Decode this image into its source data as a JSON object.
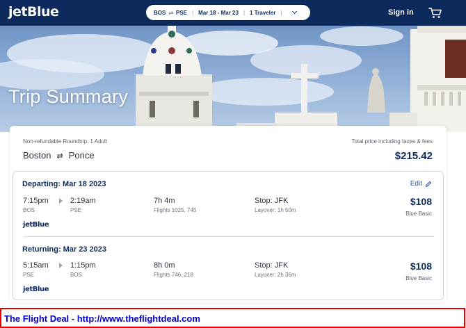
{
  "header": {
    "logo": "jetBlue",
    "search": {
      "origin": "BOS",
      "destination": "PSE",
      "dates": "Mar 18 - Mar 23",
      "travelers": "1 Traveler"
    },
    "signin_label": "Sign in",
    "icons": [
      "swap-arrows-icon",
      "chevron-down-icon",
      "cart-icon"
    ]
  },
  "hero": {
    "title": "Trip Summary"
  },
  "summary": {
    "trip_type": "Non-refundable Roundtrip, 1 Adult",
    "origin_city": "Boston",
    "destination_city": "Ponce",
    "price_label": "Total price including taxes & fees",
    "total_price": "$215.42"
  },
  "edit_label": "Edit",
  "legs": [
    {
      "heading": "Departing: Mar 18 2023",
      "depart_time": "7:15pm",
      "depart_code": "BOS",
      "arrive_time": "2:19am",
      "arrive_code": "PSE",
      "duration": "7h 4m",
      "flights": "Flights 1025, 745",
      "stop": "Stop: JFK",
      "layover": "Layover: 1h 50m",
      "price": "$108",
      "fare": "Blue Basic",
      "airline": "jetBlue"
    },
    {
      "heading": "Returning: Mar 23 2023",
      "depart_time": "5:15am",
      "depart_code": "PSE",
      "arrive_time": "1:15pm",
      "arrive_code": "BOS",
      "duration": "8h 0m",
      "flights": "Flights 746, 218",
      "stop": "Stop: JFK",
      "layover": "Layover: 2h 36m",
      "price": "$108",
      "fare": "Blue Basic",
      "airline": "jetBlue"
    }
  ],
  "banner": {
    "text": "The Flight Deal - http://www.theflightdeal.com"
  },
  "colors": {
    "navy": "#0d2a5c",
    "link": "#2b5a9a",
    "banner_border": "#e10000",
    "banner_text": "#0000cc"
  }
}
